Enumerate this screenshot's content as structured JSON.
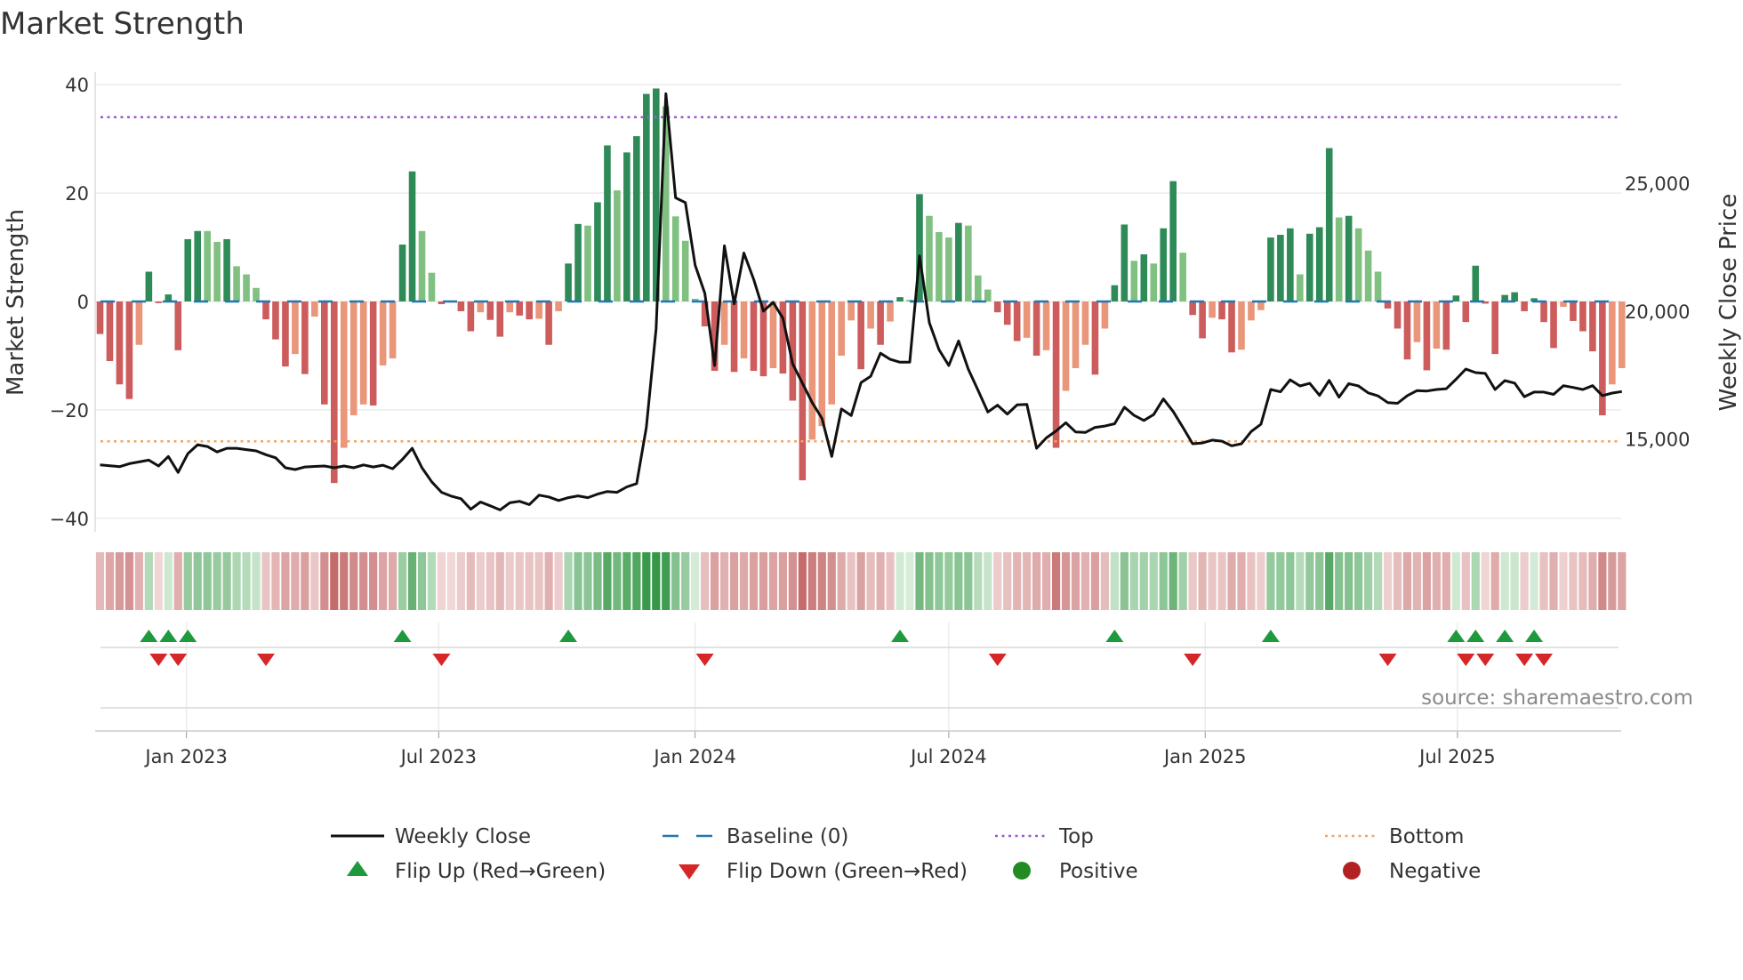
{
  "chart_data": {
    "type": "bar",
    "title": "Market Strength",
    "xlabel": "",
    "ylabel": "Market Strength",
    "y2label": "Weekly Close Price",
    "ylim": [
      -42,
      42
    ],
    "y2lim": [
      10600,
      29500
    ],
    "yticks": [
      40,
      20,
      0,
      -20,
      -40
    ],
    "ytick_labels": [
      "40",
      "20",
      "0",
      "−20",
      "−40"
    ],
    "y2ticks": [
      25000,
      20000,
      15000
    ],
    "y2tick_labels": [
      "25,000",
      "20,000",
      "15,000"
    ],
    "xticks": [
      {
        "date": "2023-01-01",
        "label": "Jan 2023"
      },
      {
        "date": "2023-07-01",
        "label": "Jul 2023"
      },
      {
        "date": "2024-01-01",
        "label": "Jan 2024"
      },
      {
        "date": "2024-07-01",
        "label": "Jul 2024"
      },
      {
        "date": "2025-01-01",
        "label": "Jan 2025"
      },
      {
        "date": "2025-07-01",
        "label": "Jul 2025"
      }
    ],
    "grid": true,
    "start_date": "2022-10-31",
    "frequency": "weekly",
    "top_level": 34,
    "bottom_level": -25.8,
    "baseline": 0,
    "strength": [
      -6,
      -11,
      -15.3,
      -18,
      -8,
      5.5,
      -0.3,
      1.3,
      -9,
      11.5,
      13,
      13,
      11,
      11.5,
      6.5,
      5,
      2.5,
      -3.3,
      -7,
      -12,
      -9.7,
      -13.4,
      -2.8,
      -19,
      -33.5,
      -27,
      -21,
      -19,
      -19.2,
      -11.8,
      -10.5,
      10.5,
      24,
      13,
      5.3,
      -0.5,
      -0.2,
      -1.8,
      -5.5,
      -2,
      -3.4,
      -6.5,
      -2,
      -2.6,
      -3.3,
      -3.2,
      -8,
      -1.8,
      7,
      14.3,
      14,
      18.3,
      28.8,
      20.5,
      27.5,
      30.5,
      38.3,
      39.3,
      36,
      15.7,
      11.2,
      0.5,
      -4.6,
      -12.8,
      -8,
      -13,
      -10.5,
      -12.8,
      -13.8,
      -12.3,
      -13.3,
      -18.3,
      -33,
      -25.5,
      -23,
      -19,
      -10,
      -3.5,
      -12.5,
      -5,
      -8,
      -3.7,
      0.8,
      0.3,
      19.8,
      15.8,
      12.8,
      11.8,
      14.5,
      14,
      4.8,
      2.2,
      -2,
      -4.3,
      -7.3,
      -6.7,
      -10,
      -9,
      -27,
      -16.5,
      -12.3,
      -8,
      -13.5,
      -5,
      3,
      14.2,
      7.5,
      8.7,
      7,
      13.5,
      22.2,
      9,
      -2.5,
      -6.8,
      -3,
      -3.3,
      -9.4,
      -8.9,
      -3.5,
      -1.6,
      11.8,
      12.3,
      13.5,
      5,
      12.5,
      13.7,
      28.3,
      15.5,
      15.8,
      13.5,
      9.4,
      5.5,
      -1.3,
      -5,
      -10.7,
      -7.5,
      -12.7,
      -8.7,
      -8.9,
      1.1,
      -3.8,
      6.6,
      -0.4,
      -9.7,
      1.2,
      1.7,
      -1.8,
      0.6,
      -3.8,
      -8.6,
      -1,
      -3.6,
      -5.5,
      -9.2,
      -21,
      -15.3,
      -12.3
    ],
    "weekly_close": [
      13980,
      13950,
      13910,
      14030,
      14100,
      14170,
      13940,
      14310,
      13690,
      14420,
      14770,
      14700,
      14490,
      14630,
      14630,
      14580,
      14530,
      14380,
      14260,
      13870,
      13800,
      13900,
      13920,
      13940,
      13870,
      13940,
      13870,
      13980,
      13900,
      13970,
      13830,
      14200,
      14630,
      13870,
      13320,
      12910,
      12760,
      12660,
      12250,
      12530,
      12380,
      12220,
      12500,
      12560,
      12430,
      12800,
      12730,
      12590,
      12700,
      12770,
      12700,
      12840,
      12940,
      12910,
      13120,
      13250,
      15450,
      19310,
      28500,
      24430,
      24240,
      21790,
      20690,
      17870,
      22550,
      20280,
      22270,
      21240,
      20000,
      20340,
      19720,
      17930,
      17180,
      16420,
      15800,
      14310,
      16170,
      15910,
      17200,
      17450,
      18350,
      18110,
      18000,
      18000,
      22160,
      19550,
      18490,
      17870,
      18830,
      17730,
      16900,
      16050,
      16320,
      15970,
      16330,
      16350,
      14630,
      15040,
      15310,
      15630,
      15270,
      15250,
      15450,
      15500,
      15590,
      16240,
      15920,
      15720,
      15950,
      16560,
      16070,
      15450,
      14810,
      14840,
      14950,
      14910,
      14730,
      14810,
      15290,
      15570,
      16930,
      16840,
      17310,
      17070,
      17170,
      16700,
      17290,
      16630,
      17160,
      17070,
      16800,
      16680,
      16420,
      16390,
      16690,
      16890,
      16870,
      16930,
      16960,
      17330,
      17730,
      17590,
      17560,
      16930,
      17280,
      17180,
      16650,
      16830,
      16830,
      16740,
      17080,
      17010,
      16930,
      17080,
      16690,
      16790,
      16850
    ],
    "legend": {
      "placement": "bottom",
      "items": [
        {
          "key": "close",
          "label": "Weekly Close"
        },
        {
          "key": "baseline",
          "label": "Baseline (0)"
        },
        {
          "key": "top",
          "label": "Top"
        },
        {
          "key": "bottom",
          "label": "Bottom"
        },
        {
          "key": "flip_up",
          "label": "Flip Up (Red→Green)"
        },
        {
          "key": "flip_down",
          "label": "Flip Down (Green→Red)"
        },
        {
          "key": "positive",
          "label": "Positive"
        },
        {
          "key": "negative",
          "label": "Negative"
        }
      ]
    },
    "annotation": "source: sharemaestro.com",
    "colors": {
      "pos_strong": "#2e8b57",
      "pos_weak": "#80c080",
      "neg_strong": "#cd5c5c",
      "neg_weak": "#e9967a",
      "close": "#111111",
      "baseline": "#1f77b4",
      "top": "#9b59d6",
      "bottom": "#f4a460",
      "flip_up": "#1e9a3c",
      "flip_down": "#d62728",
      "positive": "#228b22",
      "negative": "#b22222"
    }
  }
}
